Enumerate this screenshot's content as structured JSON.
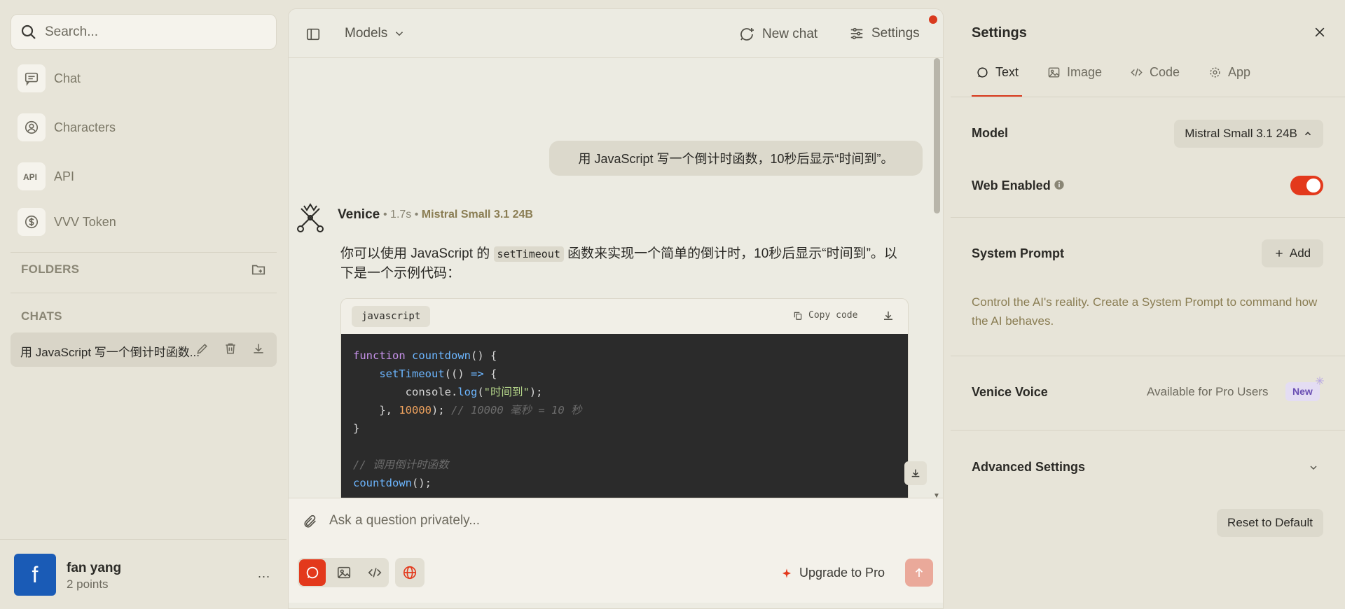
{
  "sidebar": {
    "search": {
      "placeholder": "Search..."
    },
    "nav": [
      {
        "label": "Chat",
        "icon": "chat-icon"
      },
      {
        "label": "Characters",
        "icon": "characters-icon"
      },
      {
        "label": "API",
        "icon": "api-icon"
      },
      {
        "label": "VVV Token",
        "icon": "token-icon"
      }
    ],
    "folders_label": "FOLDERS",
    "chats_label": "CHATS",
    "chats": [
      {
        "title": "用 JavaScript 写一个倒计时函数..."
      }
    ],
    "user": {
      "initial": "f",
      "name": "fan yang",
      "points": "2 points",
      "more": "..."
    }
  },
  "header": {
    "models_label": "Models",
    "new_chat_label": "New chat",
    "settings_label": "Settings"
  },
  "conversation": {
    "user_message": "用 JavaScript 写一个倒计时函数，10秒后显示“时间到”。",
    "bot": {
      "name": "Venice",
      "time": "1.7s",
      "model": "Mistral Small 3.1 24B",
      "text_before": "你可以使用 JavaScript 的",
      "inline_code": "setTimeout",
      "text_after": "函数来实现一个简单的倒计时，10秒后显示“时间到”。以下是一个示例代码：",
      "code": {
        "language": "javascript",
        "copy_label": "Copy code",
        "lines": [
          {
            "kw": "function",
            "fn": "countdown",
            "rest": "() {"
          },
          {
            "fn": "setTimeout",
            "rest1": "(() ",
            "kw": "=>",
            "rest2": " {"
          },
          {
            "obj": "console.",
            "fn": "log",
            "open": "(",
            "str": "\"时间到\"",
            "close": ");"
          },
          {
            "pre": "}, ",
            "num": "10000",
            "post": "); ",
            "comment": "// 10000 毫秒 = 10 秒"
          },
          {
            "text": "}"
          },
          {
            "comment": "// 调用倒计时函数"
          },
          {
            "fn": "countdown",
            "rest": "();"
          }
        ]
      }
    }
  },
  "composer": {
    "placeholder": "Ask a question privately...",
    "upgrade_label": "Upgrade to Pro"
  },
  "settings": {
    "title": "Settings",
    "tabs": [
      {
        "label": "Text",
        "icon": "chat-bubble-icon",
        "active": true
      },
      {
        "label": "Image",
        "icon": "image-icon"
      },
      {
        "label": "Code",
        "icon": "code-icon"
      },
      {
        "label": "App",
        "icon": "gear-icon"
      }
    ],
    "model_label": "Model",
    "model_value": "Mistral Small 3.1 24B",
    "web_enabled_label": "Web Enabled",
    "web_enabled": true,
    "system_prompt_label": "System Prompt",
    "add_label": "Add",
    "system_prompt_help": "Control the AI's reality. Create a System Prompt to command how the AI behaves.",
    "venice_voice_label": "Venice Voice",
    "venice_voice_value": "Available for Pro Users",
    "new_badge": "New",
    "advanced_label": "Advanced Settings",
    "reset_label": "Reset to Default"
  },
  "colors": {
    "accent": "#e3391c",
    "background": "#e7e4d8",
    "panel": "#ecebe2",
    "avatar": "#1a5bb6"
  }
}
